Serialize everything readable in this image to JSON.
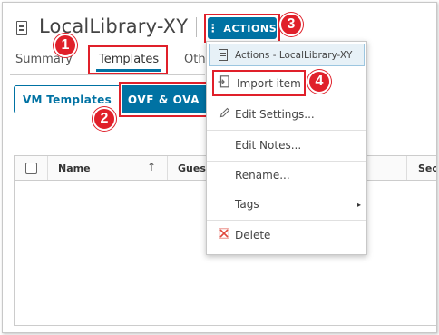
{
  "header": {
    "title": "LocalLibrary-XY",
    "actions_label": "ACTIONS",
    "actions_kebab": "⋮"
  },
  "tabs": [
    {
      "label": "Summary"
    },
    {
      "label": "Templates"
    },
    {
      "label": "Oth"
    }
  ],
  "subtabs": {
    "vm_templates": "VM Templates",
    "ovf_ova": "OVF & OVA"
  },
  "table": {
    "columns": {
      "name": "Name",
      "guest": "Guest",
      "sec": "Sec"
    },
    "sort_glyph": "↑"
  },
  "menu": {
    "header": "Actions - LocalLibrary-XY",
    "items": [
      {
        "label": "Import item",
        "icon": "import-icon"
      },
      {
        "label": "Edit Settings...",
        "icon": "pencil-icon"
      },
      {
        "label": "Edit Notes..."
      },
      {
        "label": "Rename..."
      },
      {
        "label": "Tags",
        "submenu_arrow": "▸"
      },
      {
        "label": "Delete",
        "icon": "delete-icon"
      }
    ]
  },
  "callouts": [
    "1",
    "2",
    "3",
    "4"
  ],
  "colors": {
    "accent_blue": "#0072a3",
    "callout_red": "#e0202a",
    "delete_red": "#e0483c"
  }
}
